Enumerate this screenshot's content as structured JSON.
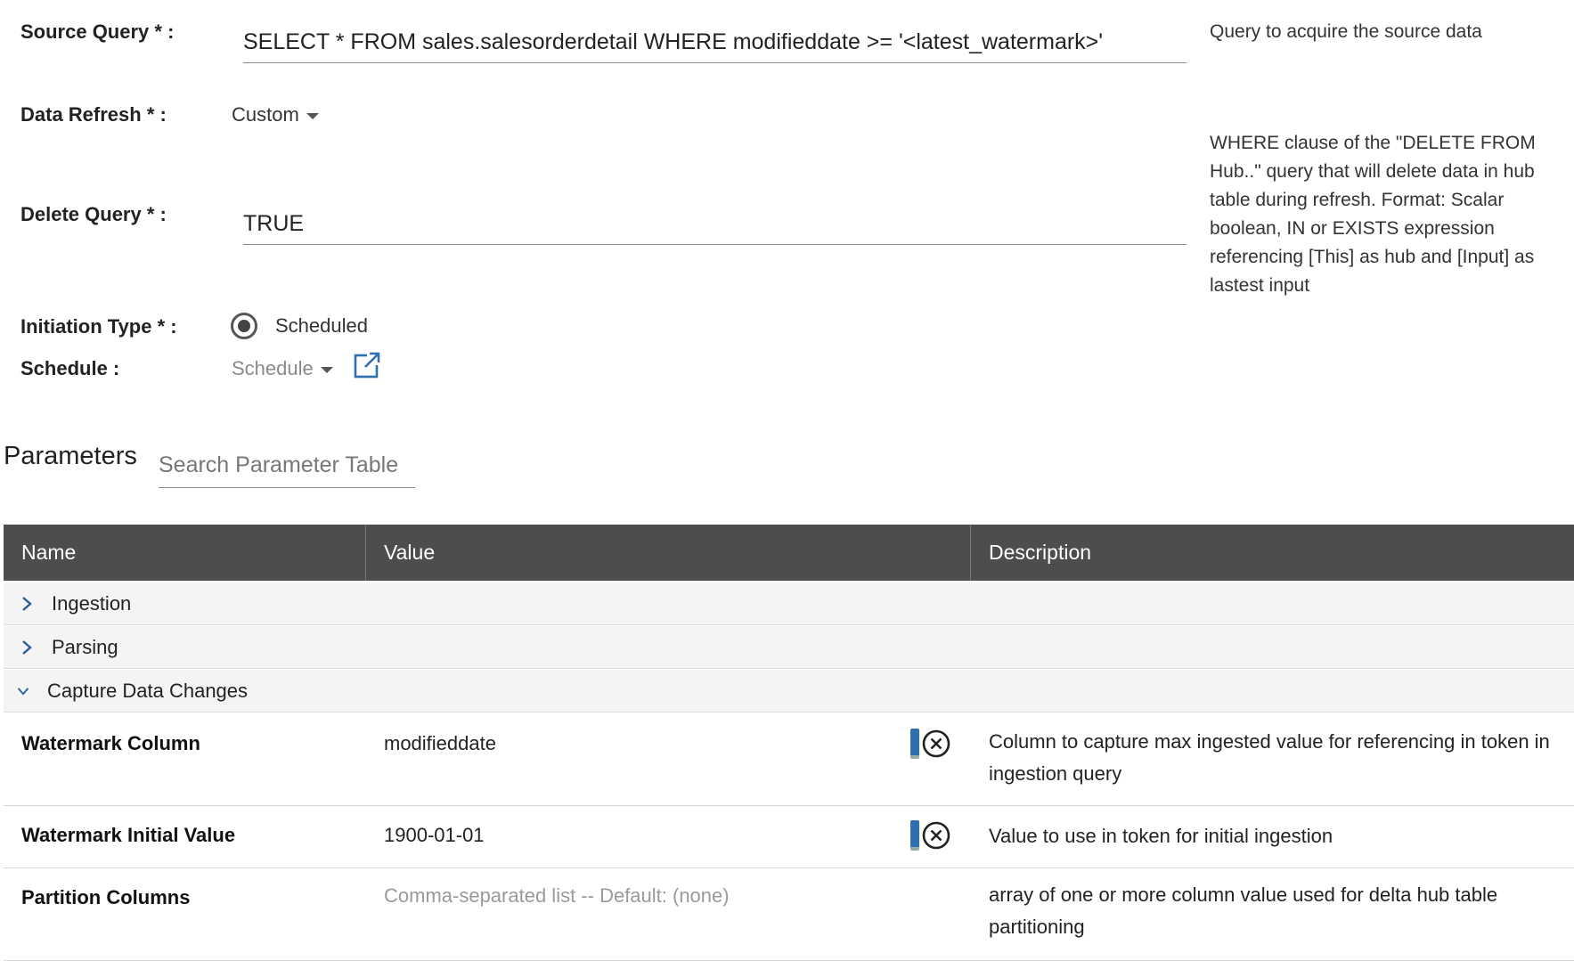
{
  "form": {
    "source_query": {
      "label": "Source Query * :",
      "value": "SELECT * FROM sales.salesorderdetail WHERE modifieddate >= '<latest_watermark>'",
      "help": "Query to acquire the source data"
    },
    "data_refresh": {
      "label": "Data Refresh * :",
      "value": "Custom"
    },
    "delete_query": {
      "label": "Delete Query * :",
      "value": "TRUE",
      "help": "WHERE clause of the \"DELETE FROM Hub..\" query that will delete data in hub table during refresh. Format: Scalar boolean, IN or EXISTS expression referencing [This] as hub and [Input] as lastest input"
    },
    "initiation_type": {
      "label": "Initiation Type * :",
      "option": "Scheduled",
      "selected": true
    },
    "schedule": {
      "label": "Schedule :",
      "value": "Schedule"
    }
  },
  "parameters": {
    "title": "Parameters",
    "search_placeholder": "Search Parameter Table",
    "columns": [
      "Name",
      "Value",
      "Description"
    ],
    "groups": [
      {
        "label": "Ingestion",
        "expanded": false
      },
      {
        "label": "Parsing",
        "expanded": false
      },
      {
        "label": "Capture Data Changes",
        "expanded": true
      }
    ],
    "rows": [
      {
        "name": "Watermark Column",
        "value": "modifieddate",
        "description": "Column to capture max ingested value for referencing in token in ingestion query"
      },
      {
        "name": "Watermark Initial Value",
        "value": "1900-01-01",
        "description": "Value to use in token for initial ingestion"
      },
      {
        "name": "Partition Columns",
        "placeholder": "Comma-separated list -- Default: (none)",
        "description": "array of one or more column value used for delta hub table partitioning"
      }
    ]
  },
  "colors": {
    "header_bg": "#4d4d4d",
    "accent_blue": "#2f6fb0",
    "chevron_blue": "#2a5d9a"
  },
  "icons": [
    "chevron-right-icon",
    "chevron-down-icon",
    "external-link-icon",
    "clear-circle-icon",
    "drag-handle-icon"
  ]
}
